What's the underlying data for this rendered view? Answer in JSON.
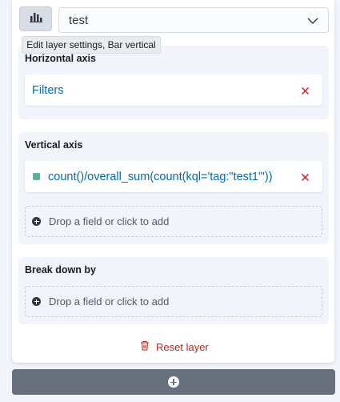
{
  "layer": {
    "selected_layer": "test",
    "settings_tooltip": "Edit layer settings, Bar vertical"
  },
  "horizontal_axis": {
    "title": "Horizontal axis",
    "items": [
      {
        "label": "Filters"
      }
    ]
  },
  "vertical_axis": {
    "title": "Vertical axis",
    "items": [
      {
        "label": "count()/overall_sum(count(kql='tag:\"test1\"'))",
        "color": "#54b399"
      }
    ],
    "drop_zone_label": "Drop a field or click to add"
  },
  "breakdown": {
    "title": "Break down by",
    "drop_zone_label": "Drop a field or click to add"
  },
  "actions": {
    "reset_label": "Reset layer"
  },
  "colors": {
    "accent_link": "#006bb8",
    "danger": "#bd271e",
    "series": "#54b399"
  }
}
